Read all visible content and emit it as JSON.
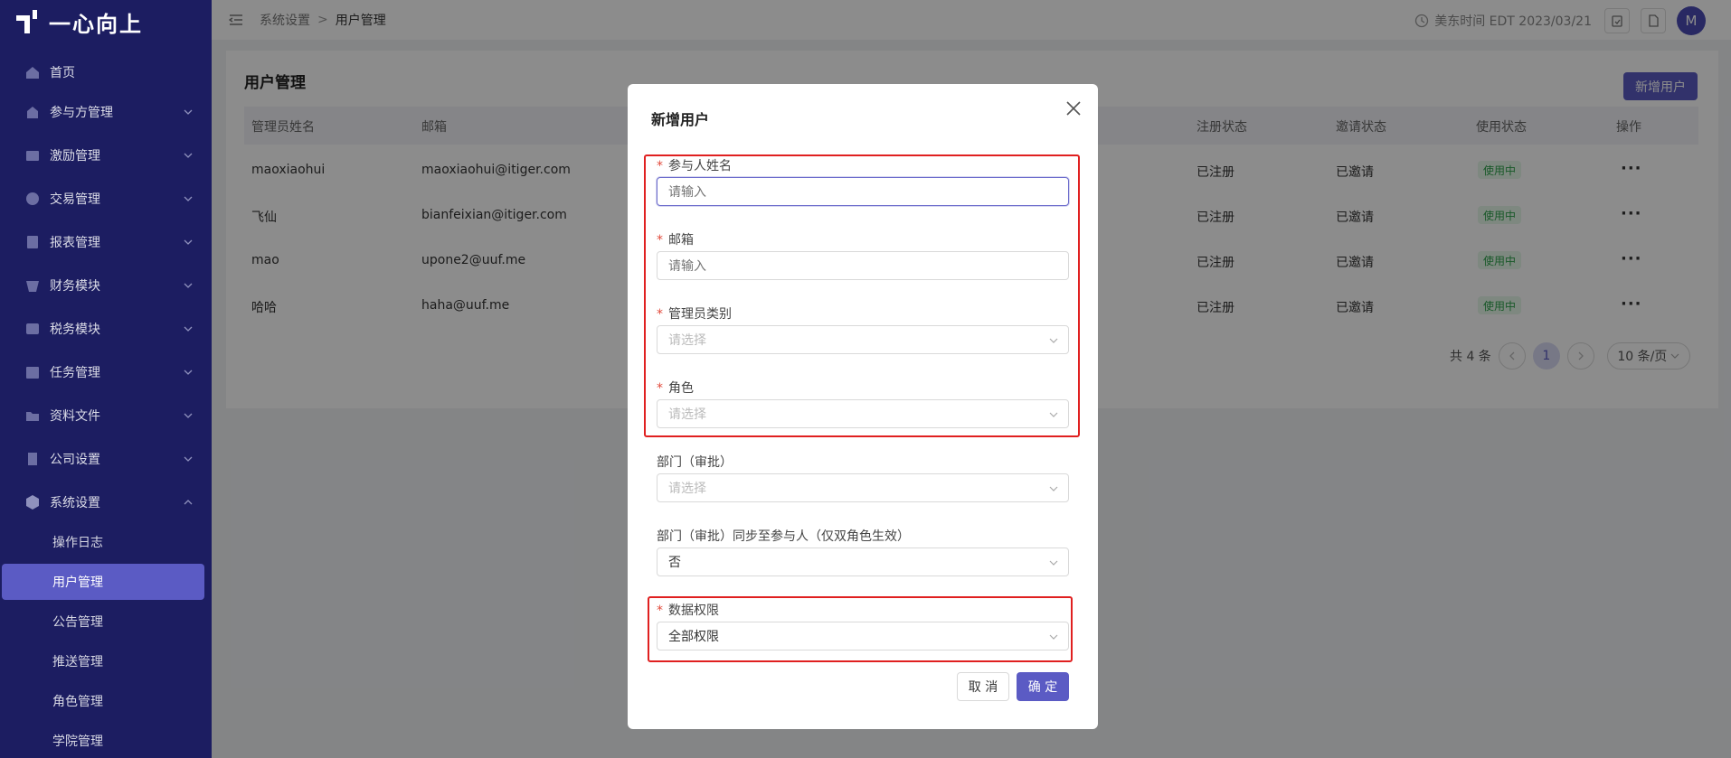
{
  "app": {
    "logo_text": "一心向上"
  },
  "sidebar": {
    "items": [
      {
        "label": "首页",
        "icon": "home-icon"
      },
      {
        "label": "参与方管理",
        "icon": "participants-icon"
      },
      {
        "label": "激励管理",
        "icon": "incentive-icon"
      },
      {
        "label": "交易管理",
        "icon": "transaction-icon"
      },
      {
        "label": "报表管理",
        "icon": "report-icon"
      },
      {
        "label": "财务模块",
        "icon": "finance-icon"
      },
      {
        "label": "税务模块",
        "icon": "tax-icon"
      },
      {
        "label": "任务管理",
        "icon": "task-icon"
      },
      {
        "label": "资料文件",
        "icon": "folder-icon"
      },
      {
        "label": "公司设置",
        "icon": "company-icon"
      },
      {
        "label": "系统设置",
        "icon": "system-icon"
      }
    ],
    "sub_items": [
      "操作日志",
      "用户管理",
      "公告管理",
      "推送管理",
      "角色管理",
      "学院管理"
    ]
  },
  "header": {
    "breadcrumb": [
      "系统设置",
      "用户管理"
    ],
    "time": "美东时间 EDT 2023/03/21",
    "avatar": "M"
  },
  "page": {
    "title": "用户管理",
    "add_button": "新增用户",
    "columns": [
      "管理员姓名",
      "邮箱",
      "注册状态",
      "邀请状态",
      "使用状态",
      "操作"
    ],
    "rows": [
      {
        "name": "maoxiaohui",
        "email": "maoxiaohui@itiger.com",
        "reg": "已注册",
        "invite": "已邀请",
        "use": "使用中"
      },
      {
        "name": "飞仙",
        "email": "bianfeixian@itiger.com",
        "reg": "已注册",
        "invite": "已邀请",
        "use": "使用中"
      },
      {
        "name": "mao",
        "email": "upone2@uuf.me",
        "reg": "已注册",
        "invite": "已邀请",
        "use": "使用中"
      },
      {
        "name": "哈哈",
        "email": "haha@uuf.me",
        "reg": "已注册",
        "invite": "已邀请",
        "use": "使用中"
      }
    ],
    "actions": "···",
    "pagination": {
      "total": "共 4 条",
      "current": "1",
      "page_size": "10 条/页"
    }
  },
  "modal": {
    "title": "新增用户",
    "fields": {
      "name": {
        "label": "参与人姓名",
        "placeholder": "请输入"
      },
      "email": {
        "label": "邮箱",
        "placeholder": "请输入"
      },
      "admin_type": {
        "label": "管理员类别",
        "placeholder": "请选择"
      },
      "role": {
        "label": "角色",
        "placeholder": "请选择"
      },
      "department": {
        "label": "部门（审批）",
        "placeholder": "请选择"
      },
      "sync": {
        "label": "部门（审批）同步至参与人（仅双角色生效）",
        "value": "否"
      },
      "data_permission": {
        "label": "数据权限",
        "value": "全部权限"
      }
    },
    "cancel": "取 消",
    "ok": "确 定"
  },
  "colors": {
    "sidebar": "#1c1d61",
    "accent": "#5b5bc4",
    "highlight": "#e02020",
    "success": "#2ca14a"
  }
}
